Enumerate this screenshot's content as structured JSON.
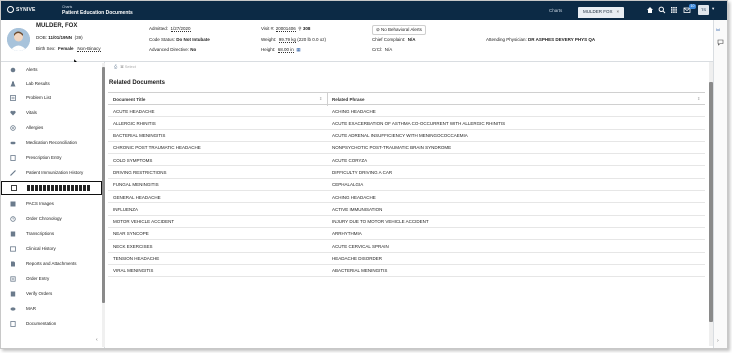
{
  "topbar": {
    "app_name": "SYNIVE",
    "crumb_small": "Charts",
    "crumb_title": "Patient Education Documents",
    "tabs": [
      "Charts",
      "MULDER FOX"
    ],
    "tab_close": "×",
    "notification_count": "10",
    "user_initials": "TS"
  },
  "patient": {
    "name": "MULDER, FOX",
    "dob_label": "DOB:",
    "dob": "11/01/19NN",
    "age": "(39)",
    "birth_sex_label": "Birth Sex:",
    "birth_sex": "Female",
    "gender": "Non-Binacy",
    "admitted_label": "Admitted:",
    "admitted": "1/27/2020",
    "code_status_label": "Code Status:",
    "code_status": "Do Not Intubate",
    "adv_directive_label": "Advanced Directive:",
    "adv_directive": "No",
    "visit_label": "Visit #:",
    "visit": "20001406",
    "room": "308",
    "weight_label": "Weight:",
    "weight": "99.79 kg",
    "weight_alt": "(220 lb 0.0 oz)",
    "height_label": "Height:",
    "height": "68.00 in",
    "alerts": "No Behavioral Alerts",
    "chief_label": "Chief Complaint:",
    "chief": "N/A",
    "crcl_label": "CrCl:",
    "crcl": "N/A",
    "physician_label": "Attending Physician:",
    "physician": "DR ASPHES DEVERY PHYS QA"
  },
  "sidebar": {
    "items": [
      {
        "label": "Alerts",
        "icon": "bell-icon"
      },
      {
        "label": "Lab Results",
        "icon": "flask-icon"
      },
      {
        "label": "Problem List",
        "icon": "list-icon"
      },
      {
        "label": "Vitals",
        "icon": "heart-icon"
      },
      {
        "label": "Allergies",
        "icon": "allergy-icon"
      },
      {
        "label": "Medication Reconciliation",
        "icon": "pill-icon"
      },
      {
        "label": "Prescription Entry",
        "icon": "rx-icon"
      },
      {
        "label": "Patient Immunization History",
        "icon": "syringe-icon"
      },
      {
        "label": "",
        "icon": "document-icon"
      },
      {
        "label": "PACS Images",
        "icon": "image-icon"
      },
      {
        "label": "Order Chronology",
        "icon": "clock-icon"
      },
      {
        "label": "Transcriptions",
        "icon": "transcript-icon"
      },
      {
        "label": "Clinical History",
        "icon": "history-icon"
      },
      {
        "label": "Reports and Attachments",
        "icon": "report-icon"
      },
      {
        "label": "Order Entry",
        "icon": "order-icon"
      },
      {
        "label": "Verify Orders",
        "icon": "verify-icon"
      },
      {
        "label": "MAR",
        "icon": "mar-icon"
      },
      {
        "label": "Documentation",
        "icon": "documentation-icon"
      }
    ],
    "collapse": "‹"
  },
  "main": {
    "toolbar_select": "Select",
    "section_title": "Related Documents",
    "columns": [
      "Document Title",
      "Related Phrase"
    ],
    "rows": [
      [
        "ACUTE HEADACHE",
        "ACHING HEADACHE"
      ],
      [
        "ALLERGIC RHINITIS",
        "ACUTE EXACERBATION OF ASTHMA CO-OCCURRENT WITH ALLERGIC RHINITIS"
      ],
      [
        "BACTERIAL MENINGITIS",
        "ACUTE ADRENAL INSUFFICIENCY WITH MENINGOCOCCAEMIA"
      ],
      [
        "CHRONIC POST TRAUMATIC HEADACHE",
        "NONPSYCHOTIC POST-TRAUMATIC BRAIN SYNDROME"
      ],
      [
        "COLD SYMPTOMS",
        "ACUTE CORYZA"
      ],
      [
        "DRIVING RESTRICTIONS",
        "DIFFICULTY DRIVING A CAR"
      ],
      [
        "FUNGAL MENINGITIS",
        "CEPHALALGIA"
      ],
      [
        "GENERAL HEADACHE",
        "ACHING HEADACHE"
      ],
      [
        "INFLUENZA",
        "ACTIVE IMMUNISATION"
      ],
      [
        "MOTOR VEHICLE ACCIDENT",
        "INJURY DUE TO MOTOR VEHICLE ACCIDENT"
      ],
      [
        "NEAR SYNCOPE",
        "ARRHYTHMIA"
      ],
      [
        "NECK EXERCISES",
        "ACUTE CERVICAL SPRAIN"
      ],
      [
        "TENSION HEADACHE",
        "HEADACHE DISORDER"
      ],
      [
        "VIRAL MENINGITIS",
        "ABACTERIAL MENINGITIS"
      ]
    ]
  },
  "colors": {
    "topbar": "#0c2a45",
    "accent": "#3b87d9",
    "link": "#2a5ea8"
  }
}
